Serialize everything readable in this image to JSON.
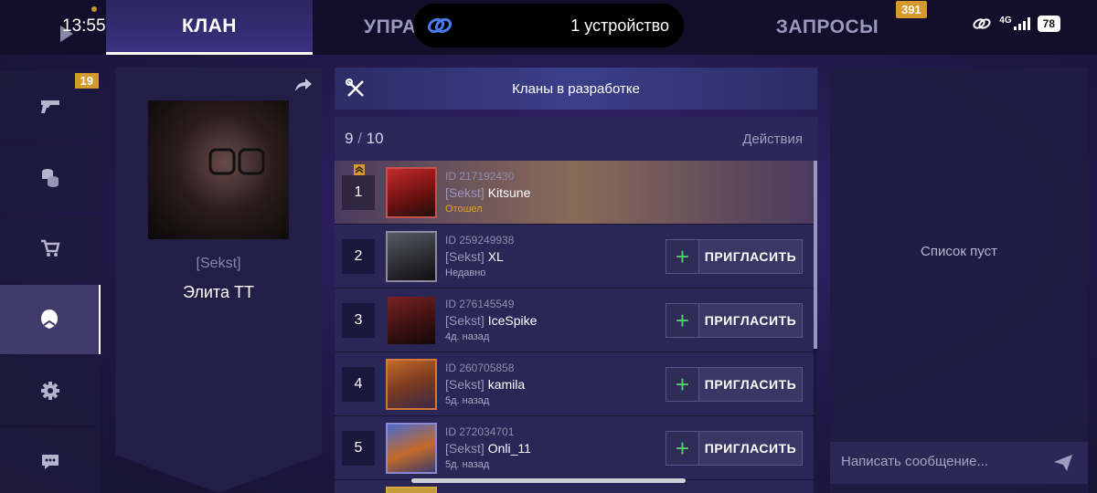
{
  "status_bar": {
    "time": "13:55",
    "network": "4G",
    "battery": "78"
  },
  "island": {
    "text": "1 устройство",
    "icon": "link-icon"
  },
  "tabs": [
    {
      "label": "КЛАН",
      "active": true
    },
    {
      "label": "УПРАВ",
      "active": false
    },
    {
      "label": "ЗАПРОСЫ",
      "active": false,
      "badge": "391"
    }
  ],
  "sidebar": {
    "items": [
      {
        "icon": "play-icon"
      },
      {
        "icon": "gun-icon",
        "badge": "19"
      },
      {
        "icon": "coins-icon"
      },
      {
        "icon": "cart-icon"
      },
      {
        "icon": "clan-icon",
        "active": true
      },
      {
        "icon": "gear-icon"
      },
      {
        "icon": "chat-icon"
      }
    ]
  },
  "profile": {
    "tag": "[Sekst]",
    "name": "Элита ТТ"
  },
  "banner": {
    "text": "Кланы в разработке"
  },
  "members_list": {
    "count": "9",
    "capacity": "10",
    "actions_label": "Действия",
    "invite_label": "ПРИГЛАСИТЬ",
    "rows": [
      {
        "rank": "1",
        "id": "ID 217192430",
        "clan": "[Sekst]",
        "name": "Kitsune",
        "status": "Отошел",
        "leader": true
      },
      {
        "rank": "2",
        "id": "ID 259249938",
        "clan": "[Sekst]",
        "name": "XL",
        "status": "Недавно"
      },
      {
        "rank": "3",
        "id": "ID 276145549",
        "clan": "[Sekst]",
        "name": "IceSpike",
        "status": "4д. назад"
      },
      {
        "rank": "4",
        "id": "ID 260705858",
        "clan": "[Sekst]",
        "name": "kamila",
        "status": "5д. назад"
      },
      {
        "rank": "5",
        "id": "ID 272034701",
        "clan": "[Sekst]",
        "name": "Onli_11",
        "status": "5д. назад"
      }
    ]
  },
  "requests_panel": {
    "empty_text": "Список пуст",
    "input_placeholder": "Написать сообщение..."
  },
  "colors": {
    "accent_gold": "#d69a2c",
    "plus_green": "#4ed36a",
    "away_orange": "#e0a030"
  }
}
